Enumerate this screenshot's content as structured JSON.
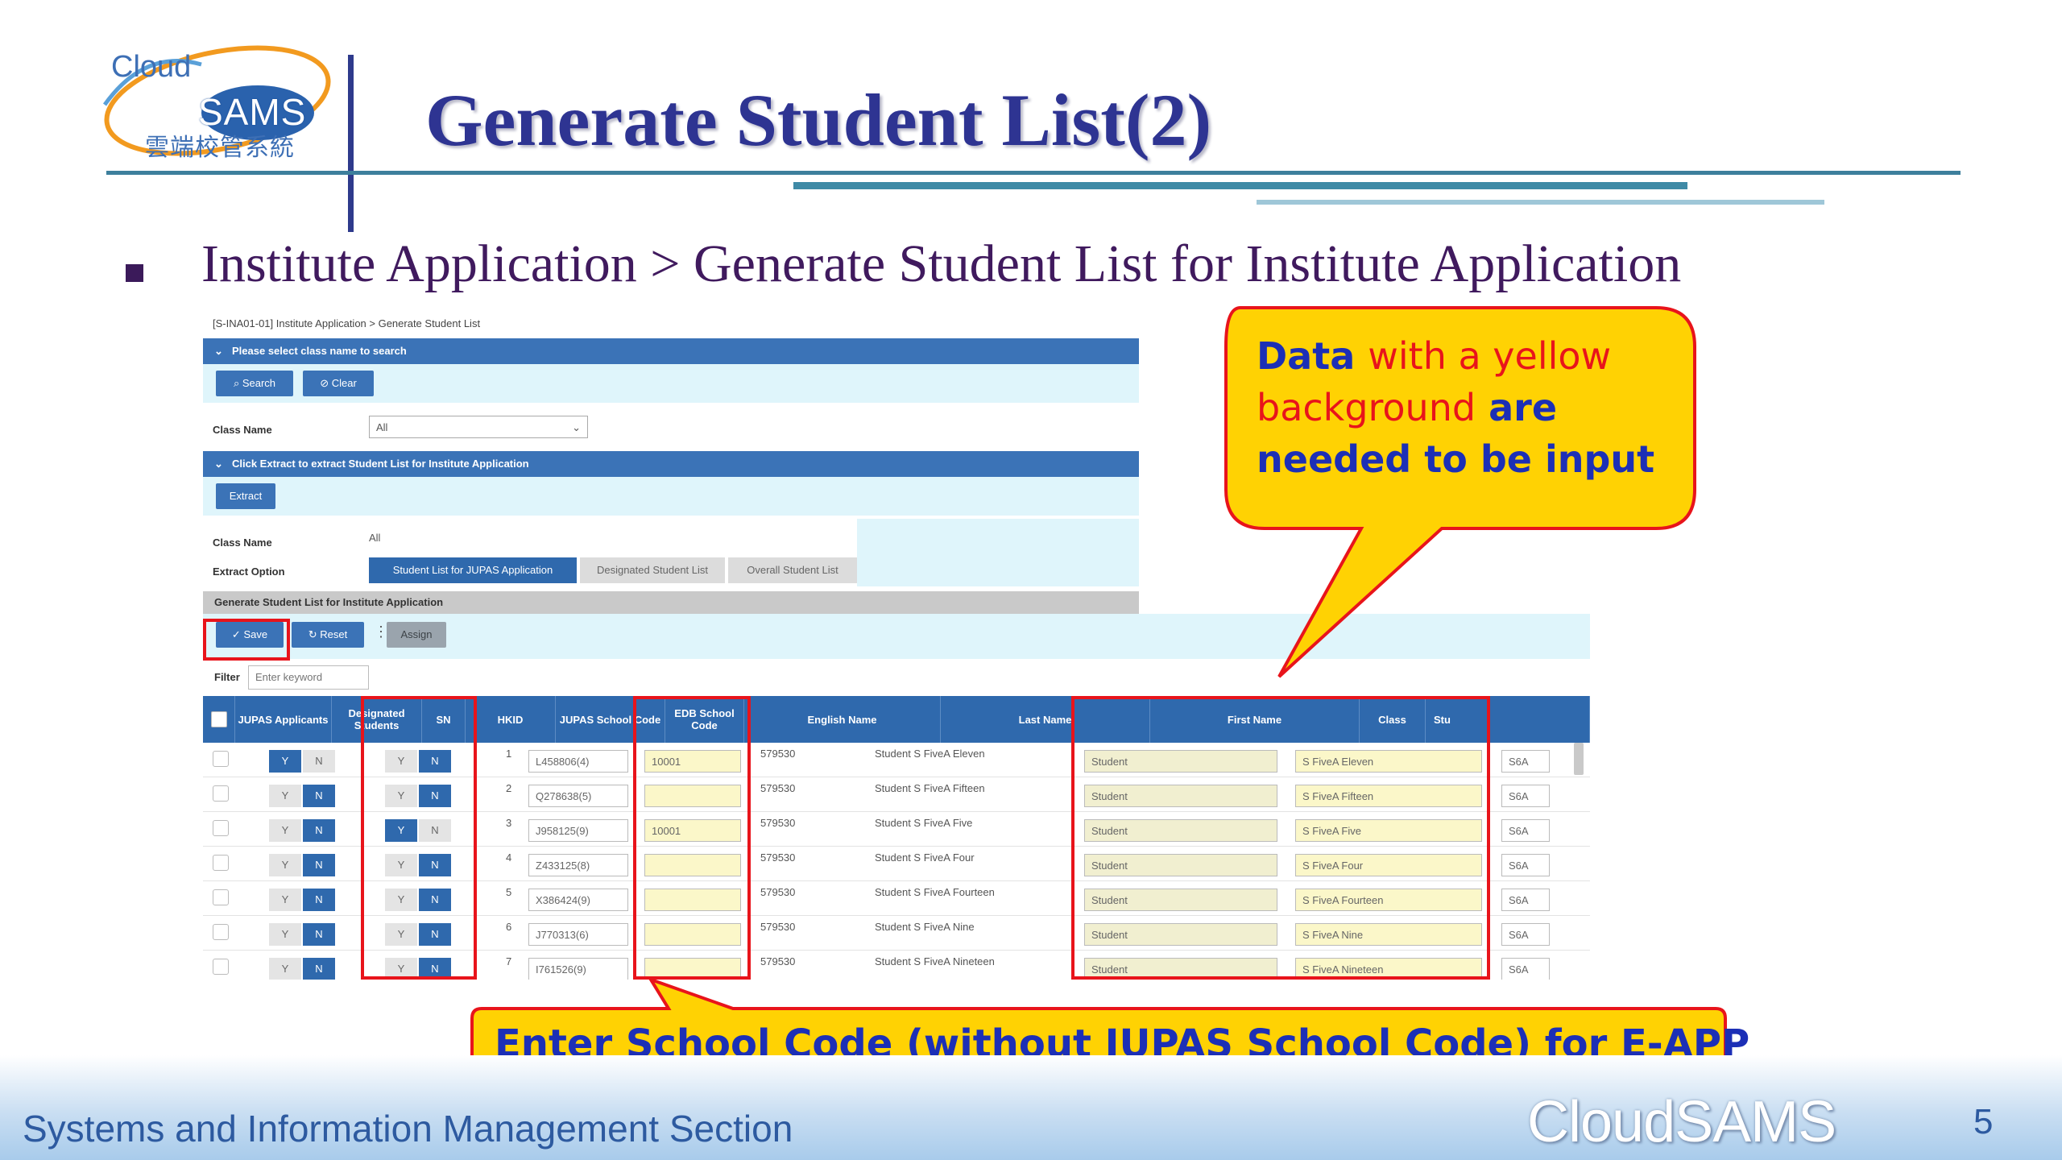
{
  "header": {
    "logo_top": "Cloud",
    "logo_main": "SAMS",
    "logo_sub": "雲端校管系統",
    "title": "Generate Student List(2)"
  },
  "subtitle": "Institute Application > Generate Student List for Institute Application",
  "app": {
    "breadcrumb": "[S-INA01-01]  Institute Application   >   Generate Student List",
    "search_section": {
      "title": "Please select class name to search",
      "search_label": "Search",
      "clear_label": "Clear",
      "class_name_label": "Class Name",
      "class_name_value": "All"
    },
    "extract_section": {
      "title": "Click Extract to extract Student List for Institute Application",
      "extract_label": "Extract",
      "class_name_label": "Class Name",
      "class_name_value": "All",
      "extract_option_label": "Extract Option",
      "options": [
        "Student List for JUPAS Application",
        "Designated Student List",
        "Overall Student List"
      ],
      "selected_option": "Student List for JUPAS Application"
    },
    "generate_section": {
      "title": "Generate Student List for Institute Application",
      "save_label": "Save",
      "reset_label": "Reset",
      "assign_label": "Assign",
      "filter_label": "Filter",
      "filter_placeholder": "Enter keyword"
    },
    "table": {
      "columns": [
        "JUPAS Applicants",
        "Designated Students",
        "SN",
        "HKID",
        "JUPAS School Code",
        "EDB School Code",
        "English Name",
        "Last Name",
        "First Name",
        "Class",
        "Stu"
      ],
      "rows": [
        {
          "jupas": "Y",
          "designated": "N",
          "sn": "1",
          "hkid": "L458806(4)",
          "jupas_code": "10001",
          "edb_code": "579530",
          "english_name": "Student S FiveA Eleven",
          "last_name": "Student",
          "first_name": "S FiveA Eleven",
          "class": "S6A"
        },
        {
          "jupas": "N",
          "designated": "N",
          "sn": "2",
          "hkid": "Q278638(5)",
          "jupas_code": "",
          "edb_code": "579530",
          "english_name": "Student S FiveA Fifteen",
          "last_name": "Student",
          "first_name": "S FiveA Fifteen",
          "class": "S6A"
        },
        {
          "jupas": "N",
          "designated": "Y",
          "sn": "3",
          "hkid": "J958125(9)",
          "jupas_code": "10001",
          "edb_code": "579530",
          "english_name": "Student S FiveA Five",
          "last_name": "Student",
          "first_name": "S FiveA Five",
          "class": "S6A"
        },
        {
          "jupas": "N",
          "designated": "N",
          "sn": "4",
          "hkid": "Z433125(8)",
          "jupas_code": "",
          "edb_code": "579530",
          "english_name": "Student S FiveA Four",
          "last_name": "Student",
          "first_name": "S FiveA Four",
          "class": "S6A"
        },
        {
          "jupas": "N",
          "designated": "N",
          "sn": "5",
          "hkid": "X386424(9)",
          "jupas_code": "",
          "edb_code": "579530",
          "english_name": "Student S FiveA Fourteen",
          "last_name": "Student",
          "first_name": "S FiveA Fourteen",
          "class": "S6A"
        },
        {
          "jupas": "N",
          "designated": "N",
          "sn": "6",
          "hkid": "J770313(6)",
          "jupas_code": "",
          "edb_code": "579530",
          "english_name": "Student S FiveA Nine",
          "last_name": "Student",
          "first_name": "S FiveA Nine",
          "class": "S6A"
        },
        {
          "jupas": "N",
          "designated": "N",
          "sn": "7",
          "hkid": "I761526(9)",
          "jupas_code": "",
          "edb_code": "579530",
          "english_name": "Student S FiveA Nineteen",
          "last_name": "Student",
          "first_name": "S FiveA Nineteen",
          "class": "S6A"
        }
      ]
    }
  },
  "callouts": {
    "yellow_note": {
      "part1": "Data",
      "part2": "with a yellow background",
      "part3": "are needed to be input"
    },
    "school_code_note": "Enter School Code (without JUPAS School Code) for E-APP"
  },
  "footer": {
    "section_name": "Systems and Information Management Section",
    "brand": "CloudSAMS",
    "page_number": "5"
  },
  "colors": {
    "title": "#2e3492",
    "app_blue": "#3b73b7",
    "highlight_red": "#e8141b",
    "callout_yellow": "#ffd203"
  }
}
